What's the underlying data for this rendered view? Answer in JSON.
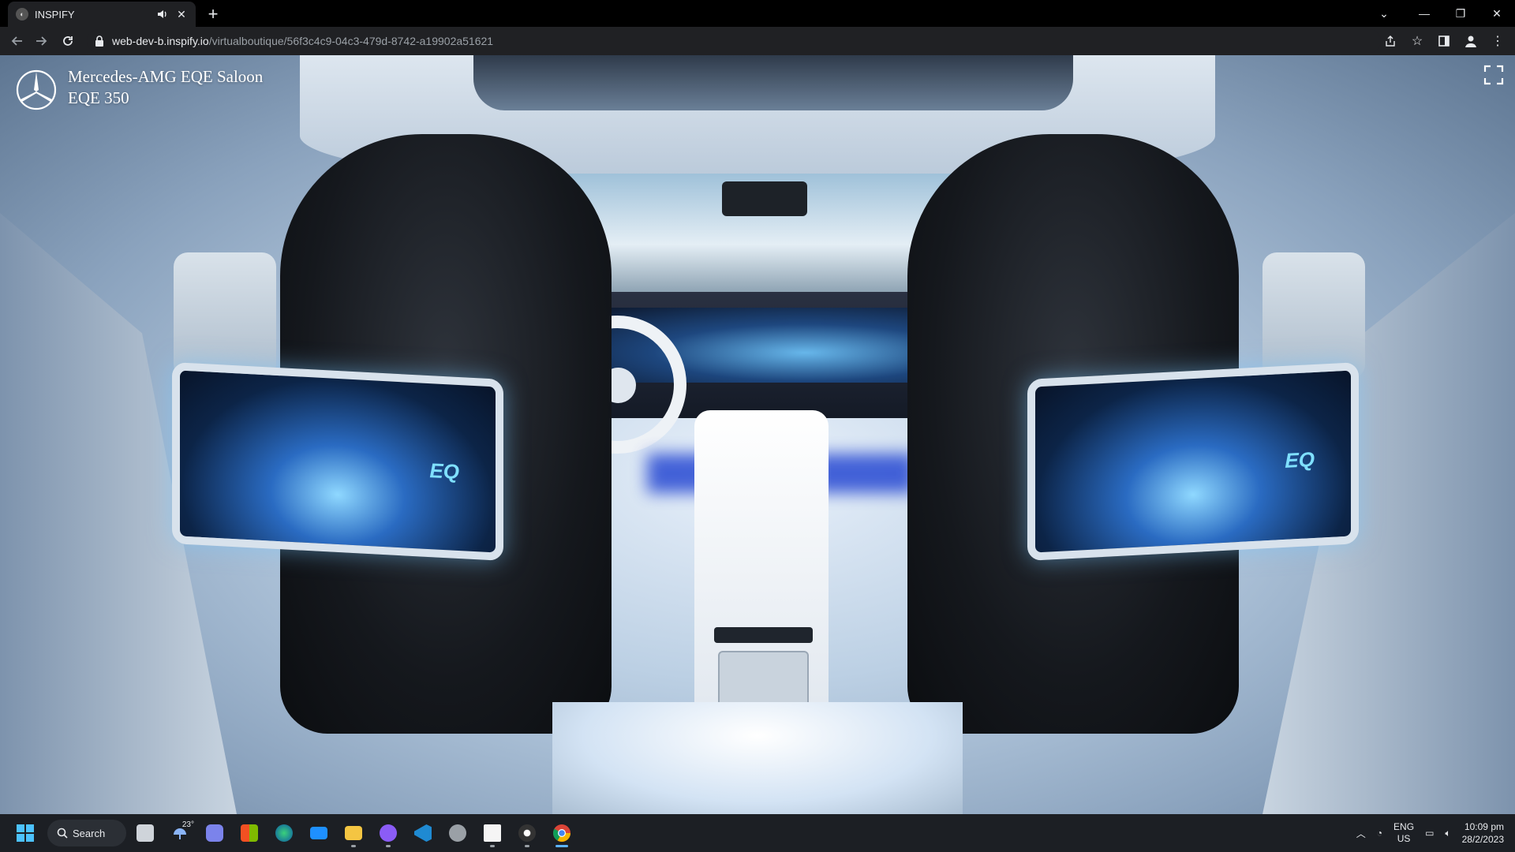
{
  "browser": {
    "tab": {
      "title": "INSPIFY"
    },
    "url": {
      "host": "web-dev-b.inspify.io",
      "path": "/virtualboutique/56f3c4c9-04c3-479d-8742-a19902a51621"
    }
  },
  "viewer": {
    "brand_icon": "mercedes-star-icon",
    "model_name": "Mercedes-AMG EQE Saloon",
    "variant": "EQE 350",
    "screen_logo": "EQ",
    "fullscreen_icon": "fullscreen-icon"
  },
  "taskbar": {
    "search_label": "Search",
    "weather_temp": "23°",
    "pinned_apps": [
      "start-icon",
      "search-icon",
      "task-view-icon",
      "weather-icon",
      "teams-chat-icon",
      "store-icon",
      "edge-icon",
      "mail-icon",
      "file-explorer-icon",
      "github-icon",
      "vscode-icon",
      "settings-icon",
      "epic-games-icon",
      "media-player-icon",
      "chrome-icon"
    ],
    "tray": {
      "lang_top": "ENG",
      "lang_bottom": "US",
      "time": "10:09 pm",
      "date": "28/2/2023"
    }
  },
  "colors": {
    "accent": "#5cb3ff",
    "chrome_bg": "#202124",
    "taskbar_bg": "#1c1f24"
  }
}
